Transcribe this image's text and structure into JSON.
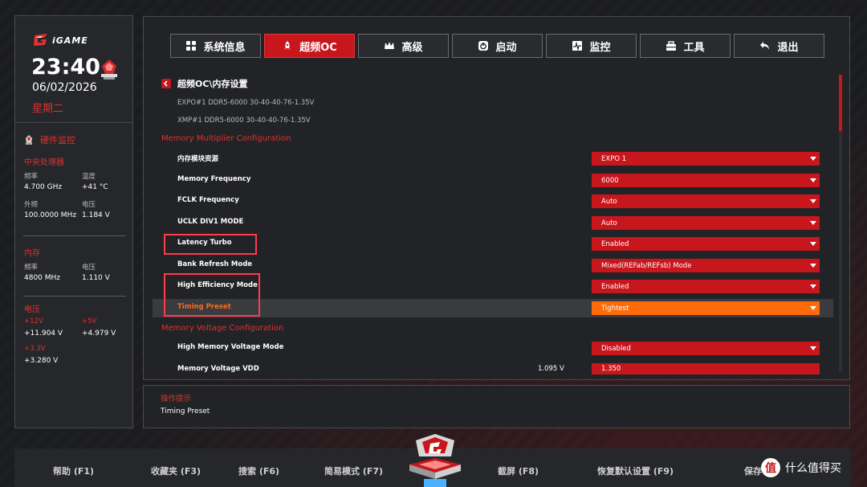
{
  "brand": {
    "logo_text": "iGAME"
  },
  "status": {
    "time": "23:40",
    "date": "06/02/2026",
    "weekday": "星期二"
  },
  "hw_monitor": {
    "title": "硬件监控",
    "cpu": {
      "title": "中央处理器",
      "freq_label": "频率",
      "freq_value": "4.700 GHz",
      "temp_label": "温度",
      "temp_value": "+41 °C",
      "ext_label": "外频",
      "ext_value": "100.0000 MHz",
      "volt_label": "电压",
      "volt_value": "1.184 V"
    },
    "memory": {
      "title": "内存",
      "freq_label": "频率",
      "freq_value": "4800 MHz",
      "volt_label": "电压",
      "volt_value": "1.110 V"
    },
    "voltage": {
      "title": "电压",
      "v12_label": "+12V",
      "v12_value": "+11.904 V",
      "v5_label": "+5V",
      "v5_value": "+4.979 V",
      "v33_label": "+3.3V",
      "v33_value": "+3.280 V"
    }
  },
  "tabs": [
    {
      "label": "系统信息",
      "icon": "grid-icon"
    },
    {
      "label": "超频OC",
      "icon": "rocket-icon"
    },
    {
      "label": "高级",
      "icon": "crown-icon"
    },
    {
      "label": "启动",
      "icon": "power-icon"
    },
    {
      "label": "监控",
      "icon": "monitor-icon"
    },
    {
      "label": "工具",
      "icon": "toolbox-icon"
    },
    {
      "label": "退出",
      "icon": "back-arrow-icon"
    }
  ],
  "active_tab": 1,
  "breadcrumb": "超频OC\\内存设置",
  "profiles": {
    "expo": "EXPO#1 DDR5-6000 30-40-40-76-1.35V",
    "xmp": "XMP#1  DDR5-6000 30-40-40-76-1.35V"
  },
  "sections": {
    "multiplier": "Memory Multiplier Configuration",
    "voltage": "Memory Voltage Configuration"
  },
  "settings": [
    {
      "label": "内存模块资源",
      "value": "EXPO 1"
    },
    {
      "label": "Memory Frequency",
      "value": "6000"
    },
    {
      "label": "FCLK Frequency",
      "value": "Auto"
    },
    {
      "label": "UCLK DIV1 MODE",
      "value": "Auto"
    },
    {
      "label": "Latency Turbo",
      "value": "Enabled"
    },
    {
      "label": "Bank Refresh Mode",
      "value": "Mixed(REFab/REFsb) Mode"
    },
    {
      "label": "High Efficiency Mode",
      "value": "Enabled"
    },
    {
      "label": "Timing Preset",
      "value": "Tightest"
    },
    {
      "label": "High Memory Voltage Mode",
      "value": "Disabled"
    },
    {
      "label": "Memory Voltage VDD",
      "value": "1.350",
      "current": "1.095 V"
    }
  ],
  "hint": {
    "title": "操作提示",
    "body": "Timing Preset"
  },
  "footer": {
    "help": "帮助 (F1)",
    "favorites": "收藏夹 (F3)",
    "search": "搜索 (F6)",
    "easy_mode": "简易模式 (F7)",
    "screenshot": "截屏 (F8)",
    "restore": "恢复默认设置 (F9)",
    "save": "保存"
  },
  "watermark": {
    "icon_text": "值",
    "text": "什么值得买"
  },
  "colors": {
    "accent": "#c8161d",
    "highlight": "#ff6a0a",
    "annotation": "#ff3b4e"
  }
}
